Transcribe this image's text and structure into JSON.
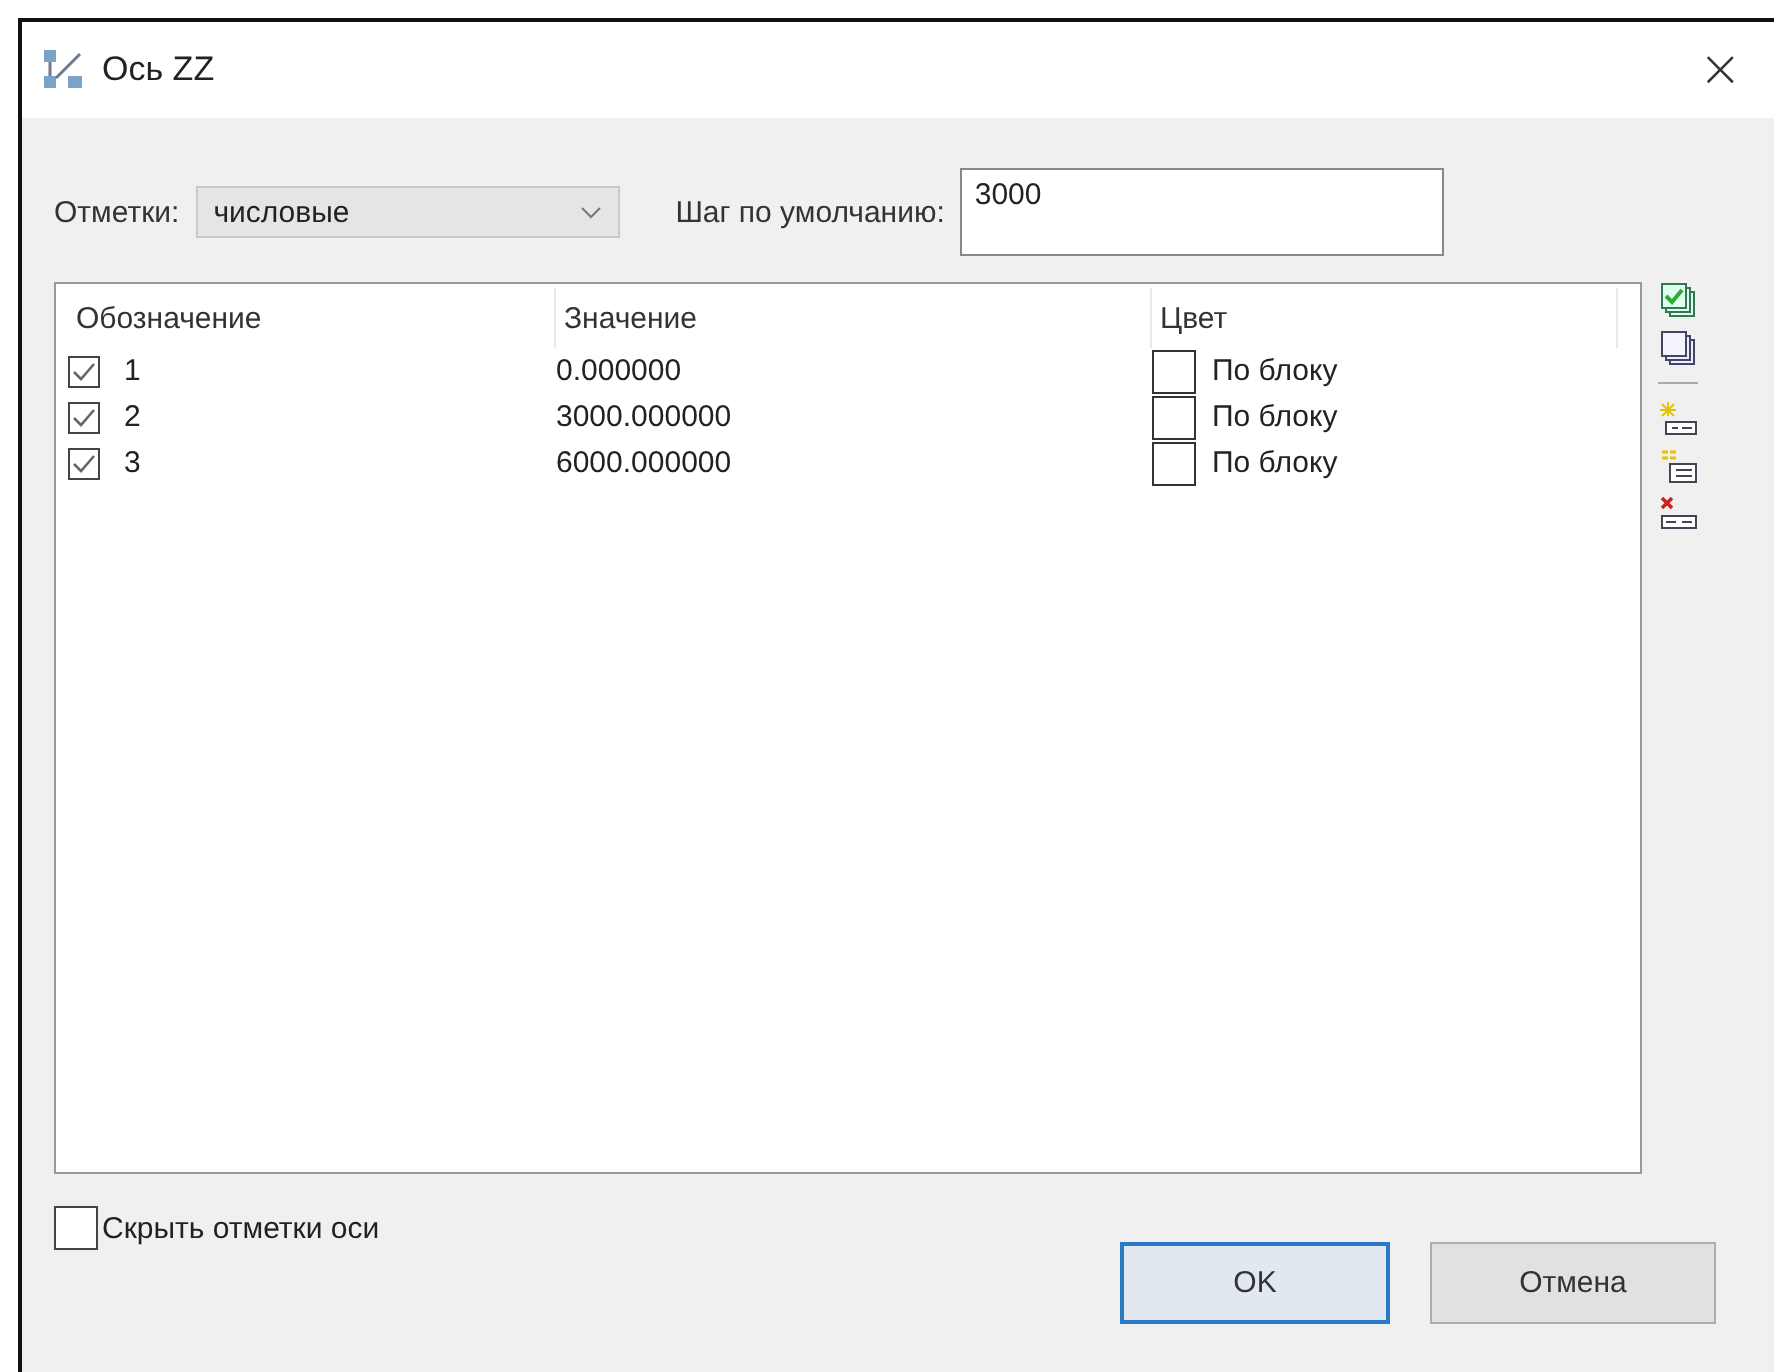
{
  "window": {
    "title": "Ось ZZ",
    "close": "×"
  },
  "marks": {
    "label": "Отметки:",
    "value": "числовые"
  },
  "step": {
    "label": "Шаг по умолчанию:",
    "value": "3000"
  },
  "table": {
    "columns": [
      "Обозначение",
      "Значение",
      "Цвет"
    ],
    "rows": [
      {
        "checked": true,
        "name": "1",
        "value": "0.000000",
        "color_label": "По блоку",
        "color": "#ffffff"
      },
      {
        "checked": true,
        "name": "2",
        "value": "3000.000000",
        "color_label": "По блоку",
        "color": "#ffffff"
      },
      {
        "checked": true,
        "name": "3",
        "value": "6000.000000",
        "color_label": "По блоку",
        "color": "#ffffff"
      }
    ]
  },
  "hide_marks": {
    "label": "Скрыть отметки оси",
    "checked": false
  },
  "buttons": [
    {
      "label": "OK",
      "default": true
    },
    {
      "label": "Отмена",
      "default": false
    }
  ]
}
